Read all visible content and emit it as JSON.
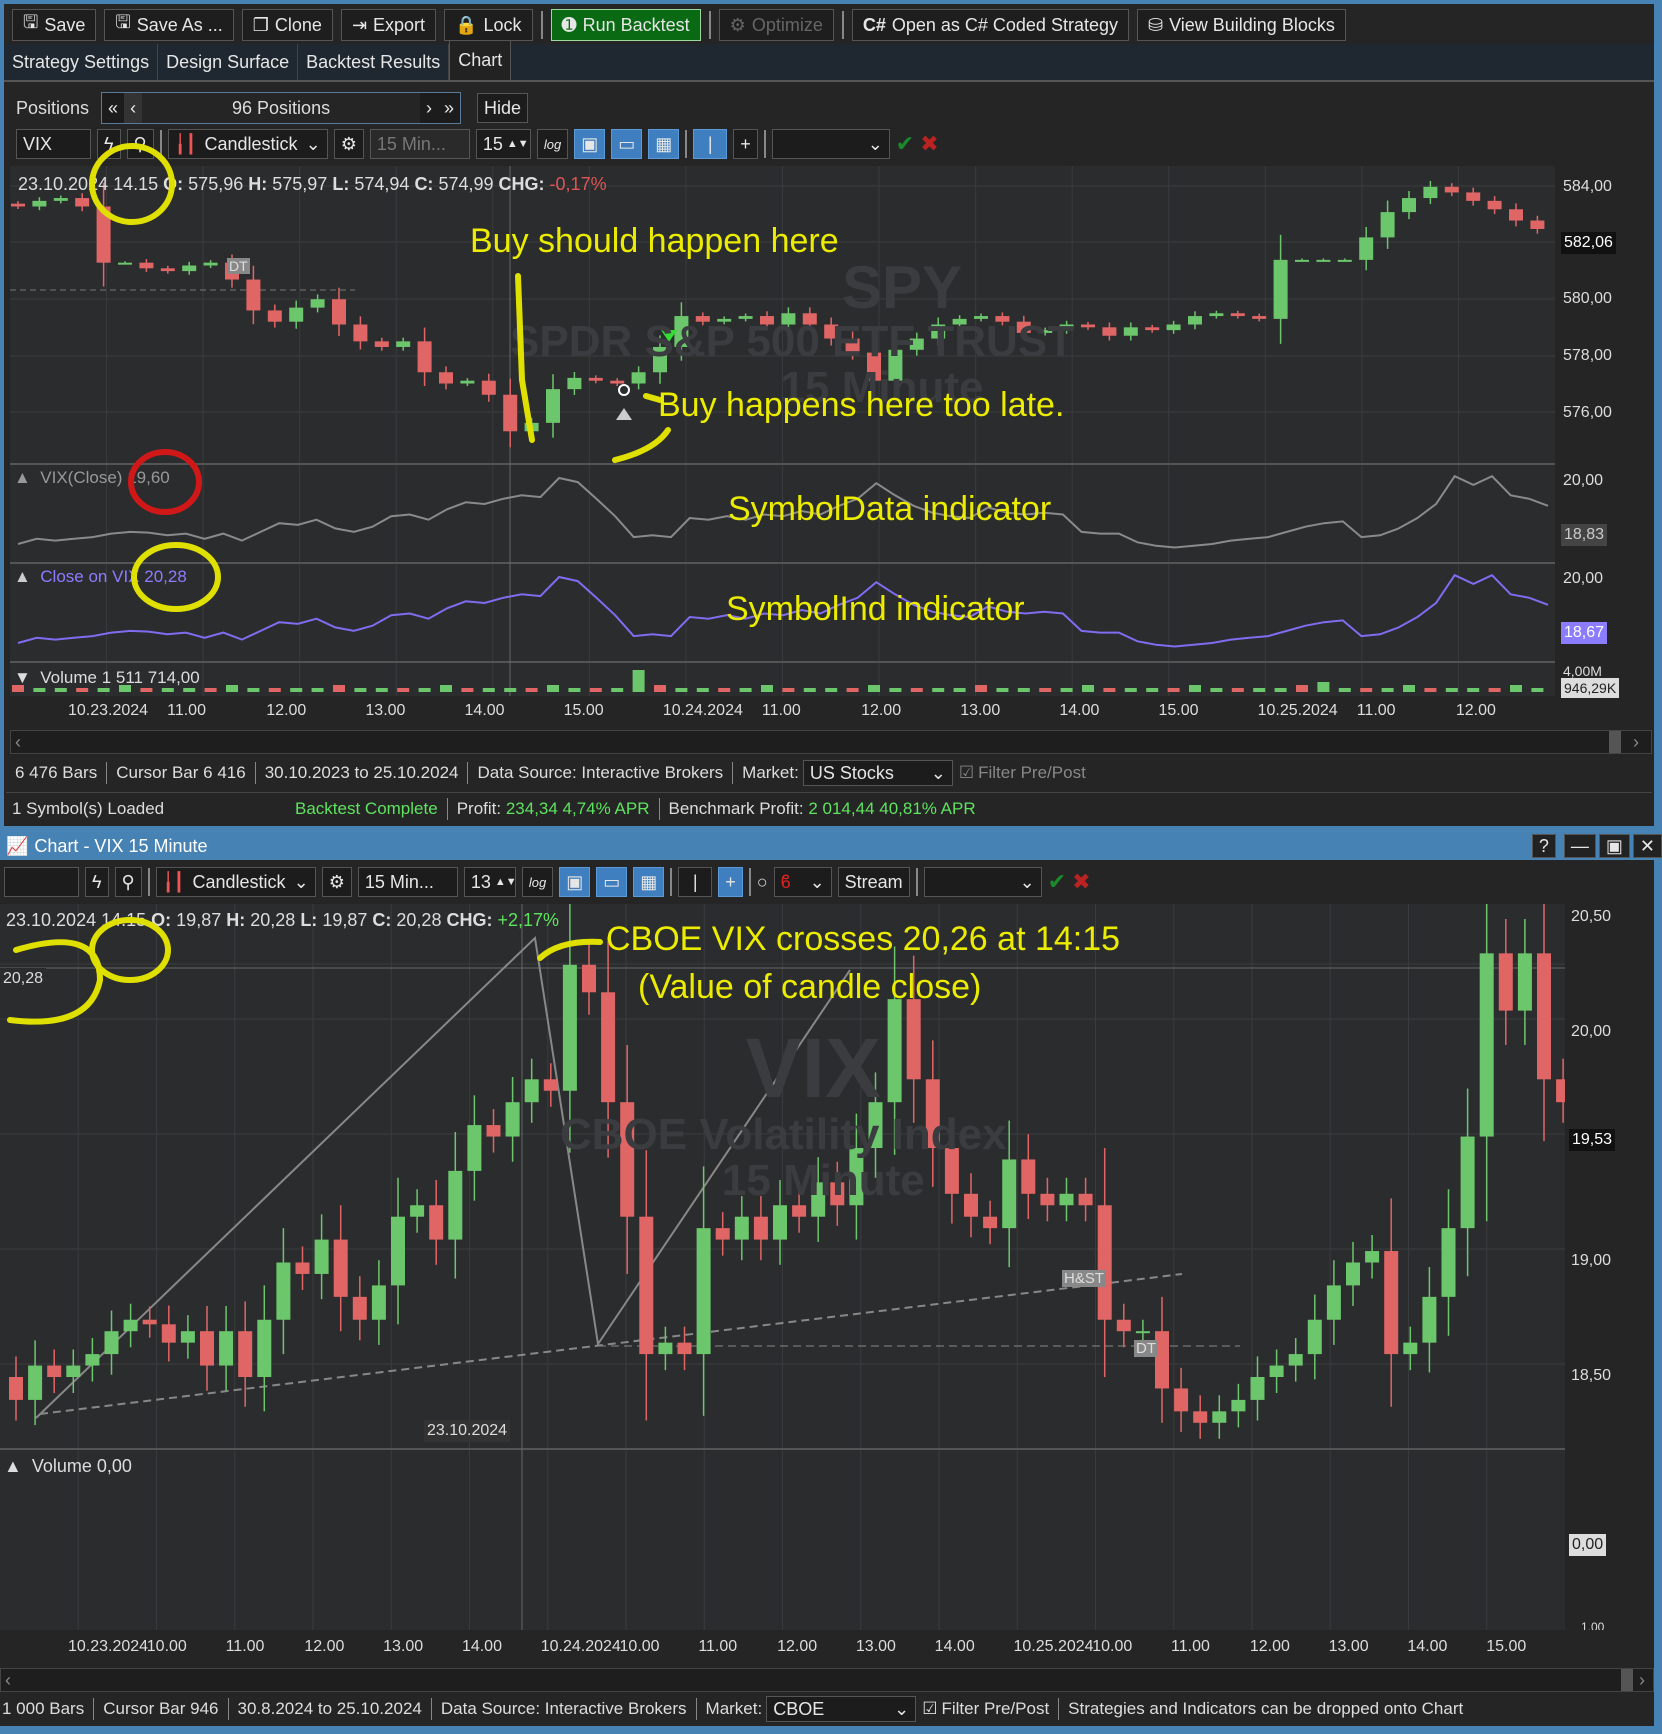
{
  "toolbar": {
    "save": "Save",
    "save_as": "Save As ...",
    "clone": "Clone",
    "export": "Export",
    "lock": "Lock",
    "run_backtest": "Run Backtest",
    "optimize": "Optimize",
    "open_csharp": "Open as C# Coded Strategy",
    "view_blocks": "View Building Blocks"
  },
  "tabs": [
    {
      "label": "Strategy Settings"
    },
    {
      "label": "Design Surface"
    },
    {
      "label": "Backtest Results"
    },
    {
      "label": "Chart",
      "active": true
    }
  ],
  "positions": {
    "label": "Positions",
    "count": "96 Positions",
    "hide": "Hide"
  },
  "upper_chart": {
    "symbol": "VIX",
    "chart_type": "Candlestick",
    "scale": "15 Min...",
    "bar_width": "15",
    "log": "log",
    "ohlc_line": {
      "date": "23.10.2024 14.15",
      "o_label": "O:",
      "o": "575,96",
      "h_label": "H:",
      "h": "575,97",
      "l_label": "L:",
      "l": "574,94",
      "c_label": "C:",
      "c": "574,99",
      "chg_label": "CHG:",
      "chg": "-0,17%"
    },
    "watermark": {
      "symbol": "SPY",
      "name": "SPDR S&P 500 ETF TRUST",
      "interval": "15 Minute"
    },
    "price_ticks": [
      "584,00",
      "580,00",
      "578,00",
      "576,00"
    ],
    "current_price": "582,06",
    "pattern_tag": "DT",
    "vix_pane": {
      "label": "VIX(Close)",
      "value": "19,60",
      "tick": "20,00",
      "last": "18,83"
    },
    "close_pane": {
      "label": "Close on VIX",
      "value": "20,28",
      "tick": "20,00",
      "last": "18,67"
    },
    "volume_pane": {
      "label": "Volume",
      "value": "1 511 714,00",
      "tick": "4,00M",
      "last": "946,29K"
    },
    "time_ticks": [
      "10.23.2024",
      "11.00",
      "12.00",
      "13.00",
      "14.00",
      "15.00",
      "10.24.2024",
      "11.00",
      "12.00",
      "13.00",
      "14.00",
      "15.00",
      "10.25.2024",
      "11.00",
      "12.00"
    ],
    "closes": [
      583.2,
      583.4,
      583.5,
      583.2,
      581.2,
      581.2,
      581.0,
      580.9,
      581.1,
      581.2,
      580.6,
      579.5,
      579.1,
      579.6,
      579.9,
      579.0,
      578.4,
      578.2,
      578.4,
      577.3,
      576.9,
      577.0,
      576.5,
      575.2,
      575.5,
      576.7,
      577.1,
      577.0,
      576.9,
      577.3,
      578.2,
      579.3,
      579.1,
      579.2,
      579.3,
      579.0,
      579.4,
      579.0,
      578.5,
      578.0,
      577.0,
      578.1,
      578.5,
      579.0,
      579.2,
      579.3,
      579.1,
      578.7,
      578.8,
      579.0,
      578.9,
      578.6,
      578.9,
      578.8,
      579.0,
      579.3,
      579.4,
      579.3,
      579.2,
      581.3,
      581.3,
      581.3,
      581.3,
      582.1,
      583.0,
      583.5,
      583.9,
      583.7,
      583.4,
      583.1,
      582.7,
      582.4
    ]
  },
  "annotations": {
    "buy_should": "Buy should happen here",
    "buy_late": "Buy happens here too late.",
    "symboldata": "SymbolData indicator",
    "symbolind": "SymbolInd indicator",
    "cboe_cross": "CBOE VIX crosses 20,26 at 14:15",
    "cboe_note": "(Value of candle close)"
  },
  "status1": {
    "bars": "6 476 Bars",
    "cursor": "Cursor Bar 6 416",
    "range": "30.10.2023 to 25.10.2024",
    "source": "Data Source: Interactive Brokers",
    "market_label": "Market:",
    "market": "US Stocks",
    "filter": "Filter Pre/Post"
  },
  "status2": {
    "loaded": "1 Symbol(s) Loaded",
    "complete": "Backtest Complete",
    "profit_label": "Profit:",
    "profit": "234,34 4,74% APR",
    "bench_label": "Benchmark Profit:",
    "bench": "2 014,44 40,81% APR"
  },
  "lower_window": {
    "title": "Chart - VIX 15 Minute",
    "help": "?",
    "chart_type": "Candlestick",
    "scale": "15 Min...",
    "bar_width": "13",
    "log": "log",
    "stream": "Stream",
    "ohlc_line": {
      "date": "23.10.2024 14.15",
      "o_label": "O:",
      "o": "19,87",
      "h_label": "H:",
      "h": "20,28",
      "l_label": "L:",
      "l": "19,87",
      "c_label": "C:",
      "c": "20,28",
      "chg_label": "CHG:",
      "chg": "+2,17%"
    },
    "watermark": {
      "symbol": "VIX",
      "name": "CBOE Volatility Index",
      "interval": "15 Minute"
    },
    "crosshair_value": "20,28",
    "crosshair_date": "23.10.2024",
    "price_ticks": [
      "20,50",
      "20,00",
      "19,00",
      "18,50"
    ],
    "current_price": "19,53",
    "pattern_tags": [
      "H&ST",
      "DT"
    ],
    "volume_pane": {
      "label": "Volume",
      "value": "0,00",
      "last": "0,00",
      "tick": "1,00"
    },
    "time_ticks": [
      "10.23.2024",
      "10.00",
      "11.00",
      "12.00",
      "13.00",
      "14.00",
      "10.24.2024",
      "10.00",
      "11.00",
      "12.00",
      "13.00",
      "14.00",
      "10.25.2024",
      "10.00",
      "11.00",
      "12.00",
      "13.00",
      "14.00",
      "15.00"
    ],
    "closes": [
      18.4,
      18.55,
      18.5,
      18.55,
      18.6,
      18.7,
      18.75,
      18.73,
      18.65,
      18.7,
      18.55,
      18.7,
      18.5,
      18.75,
      19.0,
      18.95,
      19.1,
      18.85,
      18.75,
      18.9,
      19.2,
      19.25,
      19.1,
      19.4,
      19.6,
      19.55,
      19.7,
      19.8,
      19.75,
      20.3,
      20.18,
      19.7,
      19.2,
      18.6,
      18.65,
      18.6,
      19.15,
      19.1,
      19.2,
      19.1,
      19.25,
      19.2,
      19.35,
      19.25,
      19.5,
      19.7,
      20.15,
      19.8,
      19.5,
      19.3,
      19.2,
      19.15,
      19.45,
      19.3,
      19.25,
      19.3,
      19.25,
      18.75,
      18.7,
      18.7,
      18.45,
      18.35,
      18.3,
      18.35,
      18.4,
      18.5,
      18.55,
      18.6,
      18.75,
      18.9,
      19.0,
      19.05,
      18.6,
      18.65,
      18.85,
      19.15,
      19.55,
      20.35,
      20.1,
      20.35,
      19.8,
      19.7,
      19.5
    ]
  },
  "status3": {
    "bars": "1 000 Bars",
    "cursor": "Cursor Bar 946",
    "range": "30.8.2024 to 25.10.2024",
    "source": "Data Source: Interactive Brokers",
    "market_label": "Market:",
    "market": "CBOE",
    "filter": "Filter Pre/Post",
    "hint": "Strategies and Indicators can be dropped onto Chart"
  },
  "colors": {
    "up": "#6cc66c",
    "down": "#e06666",
    "accent": "#4682b4",
    "annotation": "#ecec00",
    "profit": "#5ee35e"
  }
}
